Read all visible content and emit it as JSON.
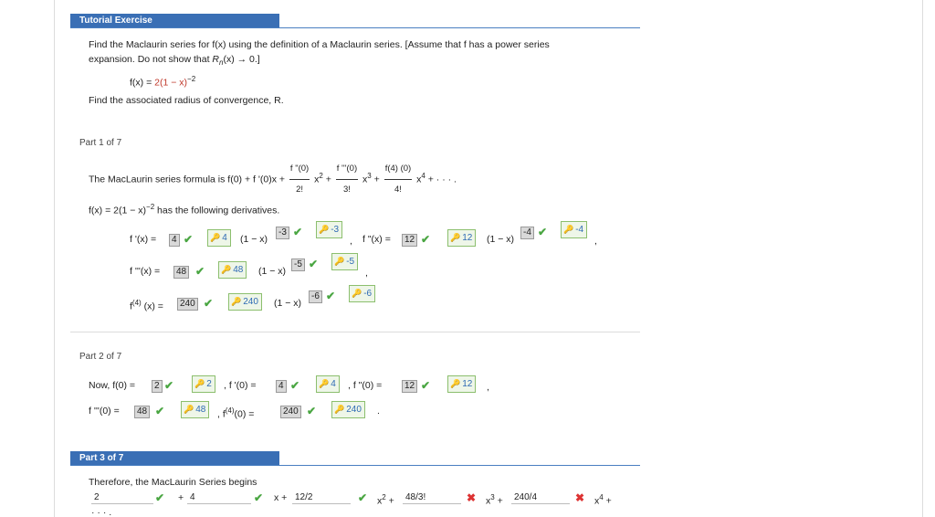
{
  "section": {
    "title": "Tutorial Exercise"
  },
  "problem": {
    "line1": "Find the Maclaurin series for f(x) using the definition of a Maclaurin series. [Assume that f has a power series",
    "line2_prefix": "expansion. Do not show that ",
    "line2_r": "R",
    "line2_sub": "n",
    "line2_suffix": "(x) → 0.]",
    "fx_prefix": "f(x) = ",
    "fx_coef": "2",
    "fx_base": "(1 − x)",
    "fx_exp": "−2",
    "radius": "Find the associated radius of convergence, R."
  },
  "part1": {
    "label": "Part 1 of 7",
    "formula_prefix": "The MacLaurin series formula is  f(0) + f '(0)x + ",
    "f2_num": "f \"(0)",
    "f2_den": "2!",
    "x2": "x",
    "x2_exp": "2",
    "plus": " + ",
    "f3_num": "f '''(0)",
    "f3_den": "3!",
    "x3": "x",
    "x3_exp": "3",
    "f4_num": "f(4) (0)",
    "f4_den": "4!",
    "x4": "x",
    "x4_exp": "4",
    "tail": " + · · · .",
    "derivs_prefix": "f(x) = 2(1 − x)",
    "derivs_exp": "−2",
    "derivs_suffix": "  has the following derivatives.",
    "d1_label": "f '(x) = ",
    "d1_coef": "4",
    "d1_key": "4",
    "d1_base": "(1 − x)",
    "d1_exp": "-3",
    "d1_exp_key": "-3",
    "d2_label": "f \"(x) = ",
    "d2_coef": "12",
    "d2_key": "12",
    "d2_base": "(1 − x)",
    "d2_exp": "-4",
    "d2_exp_key": "-4",
    "d3_label": "f '''(x) = ",
    "d3_coef": "48",
    "d3_key": "48",
    "d3_base": "(1 − x)",
    "d3_exp": "-5",
    "d3_exp_key": "-5",
    "d4_label": "f",
    "d4_sup": "(4)",
    "d4_label2": " (x) = ",
    "d4_coef": "240",
    "d4_key": "240",
    "d4_base": "(1 − x)",
    "d4_exp": "-6",
    "d4_exp_key": "-6"
  },
  "part2": {
    "label": "Part 2 of 7",
    "now": "Now,  f(0) = ",
    "v0": "2",
    "k0": "2",
    "l1": ",  f '(0) = ",
    "v1": "4",
    "k1": "4",
    "l2": ",  f \"(0) = ",
    "v2": "12",
    "k2": "12",
    "l3": "f '''(0) = ",
    "v3": "48",
    "k3": "48",
    "l4a": ",  f",
    "l4sup": "(4)",
    "l4b": "(0) = ",
    "v4": "240",
    "k4": "240"
  },
  "part3": {
    "label": "Part 3 of 7",
    "text": "Therefore, the MacLaurin Series begins",
    "in0": "2",
    "in1": "4",
    "in2": "12/2",
    "in3": "48/3!",
    "in4": "240/4",
    "plus": "+",
    "x": "x +",
    "x2": "x",
    "x2e": "2",
    "x3": "x",
    "x3e": "3",
    "x4": "x",
    "x4e": "4",
    "ell": "· · · ."
  },
  "marks": {
    "comma": ",",
    "period": "."
  }
}
